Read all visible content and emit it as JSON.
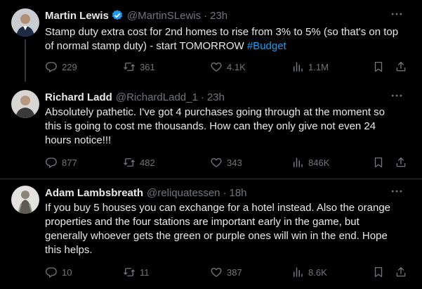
{
  "tweets": [
    {
      "name": "Martin Lewis",
      "verified": true,
      "handle": "@MartinSLewis",
      "separator": "·",
      "time": "23h",
      "text_lines": [
        "Stamp duty extra cost for 2nd homes to rise from 3% to 5% (so that's on top",
        "of normal stamp duty) - start TOMORROW "
      ],
      "hashtag": "#Budget",
      "replies": "229",
      "retweets": "361",
      "likes": "4.1K",
      "views": "1.1M"
    },
    {
      "name": "Richard Ladd",
      "handle": "@RichardLadd_1",
      "separator": "·",
      "time": "23h",
      "text_lines": [
        "Absolutely pathetic. I've got 4 purchases going through at the moment so",
        "this is going to cost me thousands. How can they only give not even 24",
        "hours notice!!!"
      ],
      "replies": "877",
      "retweets": "482",
      "likes": "343",
      "views": "846K"
    },
    {
      "name": "Adam Lambsbreath",
      "handle": "@reliquatessen",
      "separator": "·",
      "time": "18h",
      "text_lines": [
        "If you buy 5 houses you can exchange for a hotel instead. Also the orange",
        "properties and the four stations are important early in the game, but",
        "generally whoever gets the green or purple ones will win in the end. Hope",
        "this helps."
      ],
      "replies": "10",
      "retweets": "11",
      "likes": "387",
      "views": "8.6K"
    }
  ],
  "icons": {
    "reply": "reply-icon",
    "retweet": "retweet-icon",
    "like": "heart-icon",
    "views": "views-icon",
    "bookmark": "bookmark-icon",
    "share": "share-icon",
    "more": "more-icon",
    "verified": "verified-badge-icon"
  },
  "colors": {
    "background": "#000000",
    "text": "#e7e9ea",
    "muted": "#71767b",
    "accent": "#1d9bf0",
    "divider": "#2f3336"
  }
}
